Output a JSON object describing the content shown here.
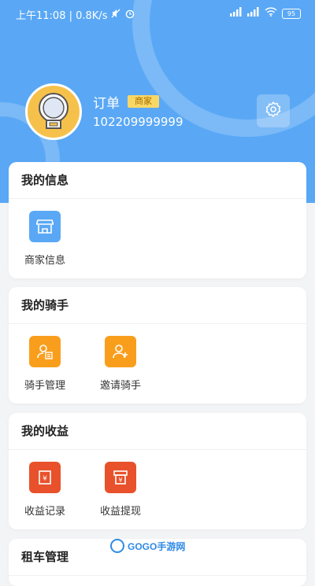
{
  "status_bar": {
    "time_info": "上午11:08 | 0.8K/s",
    "battery": "95"
  },
  "profile": {
    "name": "订单",
    "role": "商家",
    "phone": "102209999999"
  },
  "sections": [
    {
      "title": "我的信息",
      "items": [
        {
          "label": "商家信息",
          "icon": "store-icon",
          "color": "#5aa8f5"
        }
      ]
    },
    {
      "title": "我的骑手",
      "items": [
        {
          "label": "骑手管理",
          "icon": "rider-manage-icon",
          "color": "#f99e1c"
        },
        {
          "label": "邀请骑手",
          "icon": "invite-rider-icon",
          "color": "#f99e1c"
        }
      ]
    },
    {
      "title": "我的收益",
      "items": [
        {
          "label": "收益记录",
          "icon": "income-record-icon",
          "color": "#e8512b"
        },
        {
          "label": "收益提现",
          "icon": "withdraw-icon",
          "color": "#e8512b"
        }
      ]
    },
    {
      "title": "租车管理",
      "items": []
    }
  ],
  "watermark": {
    "text": "GOGO手游网"
  }
}
